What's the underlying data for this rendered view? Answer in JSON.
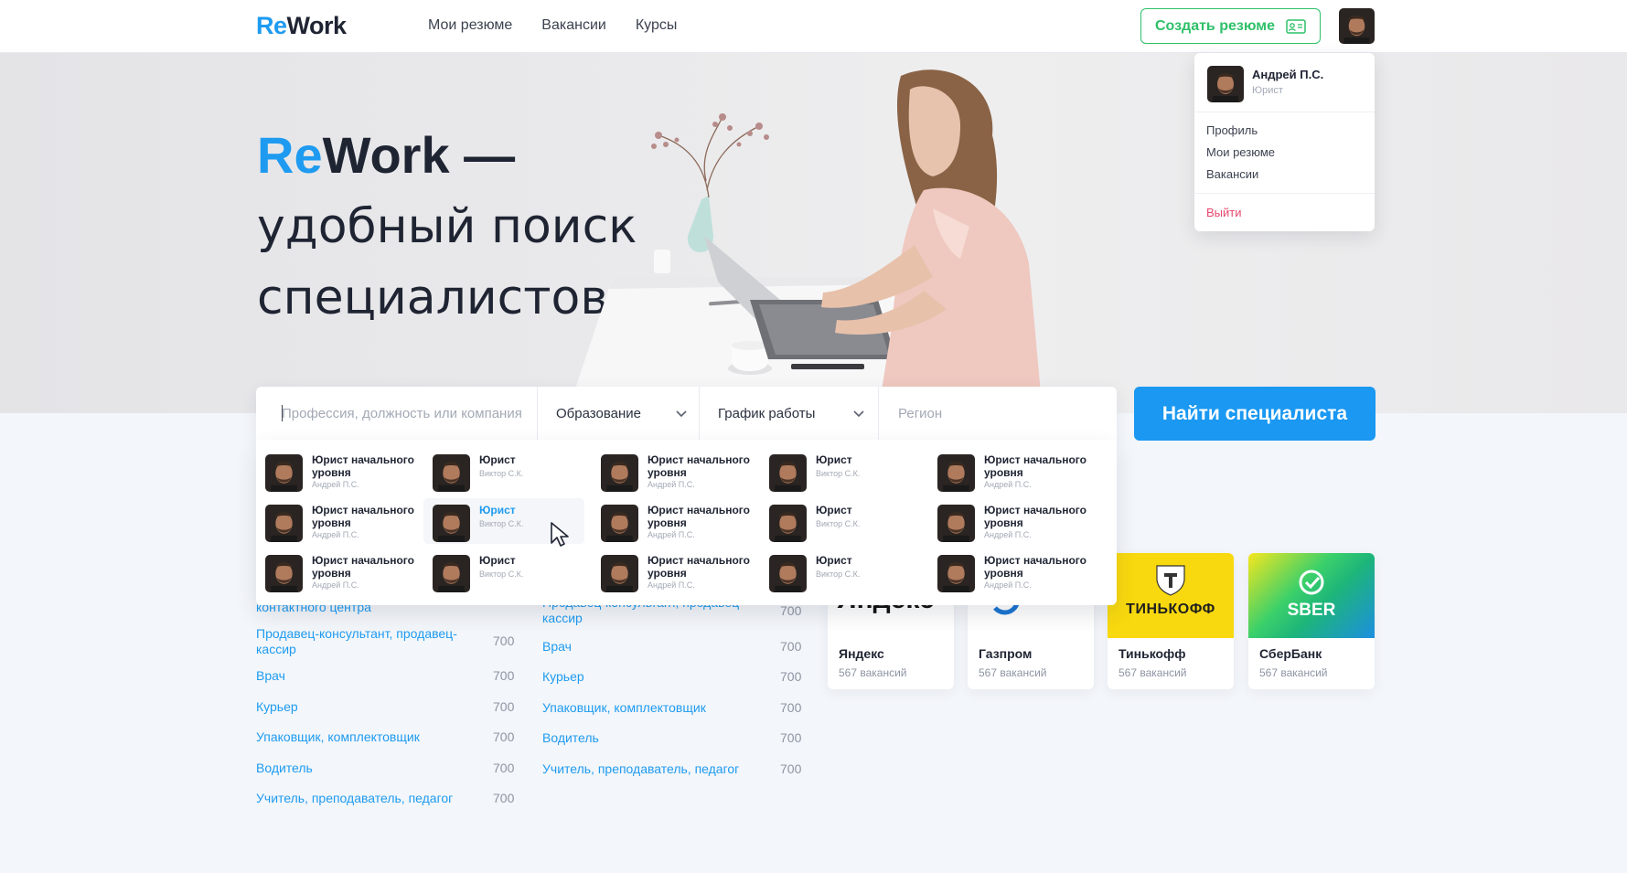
{
  "header": {
    "logo_re": "Re",
    "logo_work": "Work",
    "nav": [
      "Мои резюме",
      "Вакансии",
      "Курсы"
    ],
    "create_resume": "Создать резюме"
  },
  "user_menu": {
    "name": "Андрей П.С.",
    "role": "Юрист",
    "items": [
      "Профиль",
      "Мои резюме",
      "Вакансии"
    ],
    "logout": "Выйти"
  },
  "hero": {
    "title_re": "Re",
    "title_work": "Work —",
    "line2": "удобный поиск",
    "line3": "специалистов"
  },
  "search": {
    "placeholder": "Профессия, должность или компания",
    "education": "Образование",
    "schedule": "График работы",
    "region_placeholder": "Регион",
    "button": "Найти специалиста"
  },
  "suggestions": [
    [
      {
        "title": "Юрист начального уровня",
        "sub": "Андрей П.С."
      },
      {
        "title": "Юрист",
        "sub": "Виктор С.К."
      },
      {
        "title": "Юрист начального уровня",
        "sub": "Андрей П.С."
      },
      {
        "title": "Юрист",
        "sub": "Виктор С.К."
      },
      {
        "title": "Юрист начального уровня",
        "sub": "Андрей П.С."
      }
    ],
    [
      {
        "title": "Юрист начального уровня",
        "sub": "Андрей П.С."
      },
      {
        "title": "Юрист",
        "sub": "Виктор С.К.",
        "active": true
      },
      {
        "title": "Юрист начального уровня",
        "sub": "Андрей П.С."
      },
      {
        "title": "Юрист",
        "sub": "Виктор С.К."
      },
      {
        "title": "Юрист начального уровня",
        "sub": "Андрей П.С."
      }
    ],
    [
      {
        "title": "Юрист начального уровня",
        "sub": "Андрей П.С."
      },
      {
        "title": "Юрист",
        "sub": "Виктор С.К."
      },
      {
        "title": "Юрист начального уровня",
        "sub": "Андрей П.С."
      },
      {
        "title": "Юрист",
        "sub": "Виктор С.К."
      },
      {
        "title": "Юрист начального уровня",
        "sub": "Андрей П.С."
      }
    ]
  ],
  "jobs_col1": [
    {
      "label": "контактного центра",
      "count": ""
    },
    {
      "label": "Продавец-консультант, продавец-кассир",
      "count": "700"
    },
    {
      "label": "Врач",
      "count": "700"
    },
    {
      "label": "Курьер",
      "count": "700"
    },
    {
      "label": "Упаковщик, комплектовщик",
      "count": "700"
    },
    {
      "label": "Водитель",
      "count": "700"
    },
    {
      "label": "Учитель, преподаватель, педагог",
      "count": "700"
    }
  ],
  "jobs_col2": [
    {
      "label": "Продавец-консультант, продавец-кассир",
      "count": "700"
    },
    {
      "label": "Врач",
      "count": "700"
    },
    {
      "label": "Курьер",
      "count": "700"
    },
    {
      "label": "Упаковщик, комплектовщик",
      "count": "700"
    },
    {
      "label": "Водитель",
      "count": "700"
    },
    {
      "label": "Учитель, преподаватель, педагог",
      "count": "700"
    }
  ],
  "companies": [
    {
      "name": "Яндекс",
      "sub": "567 вакансий",
      "logo_text": "Яндекс"
    },
    {
      "name": "Газпром",
      "sub": "567 вакансий",
      "logo_text": ""
    },
    {
      "name": "Тинькофф",
      "sub": "567 вакансий",
      "logo_text": "ТИНЬКОФФ"
    },
    {
      "name": "СберБанк",
      "sub": "567 вакансий",
      "logo_text": "SBER"
    }
  ],
  "colors": {
    "accent": "#1e9bf0",
    "green": "#2fc06a",
    "logout": "#e8476d",
    "tinkoff": "#f8d90f"
  }
}
